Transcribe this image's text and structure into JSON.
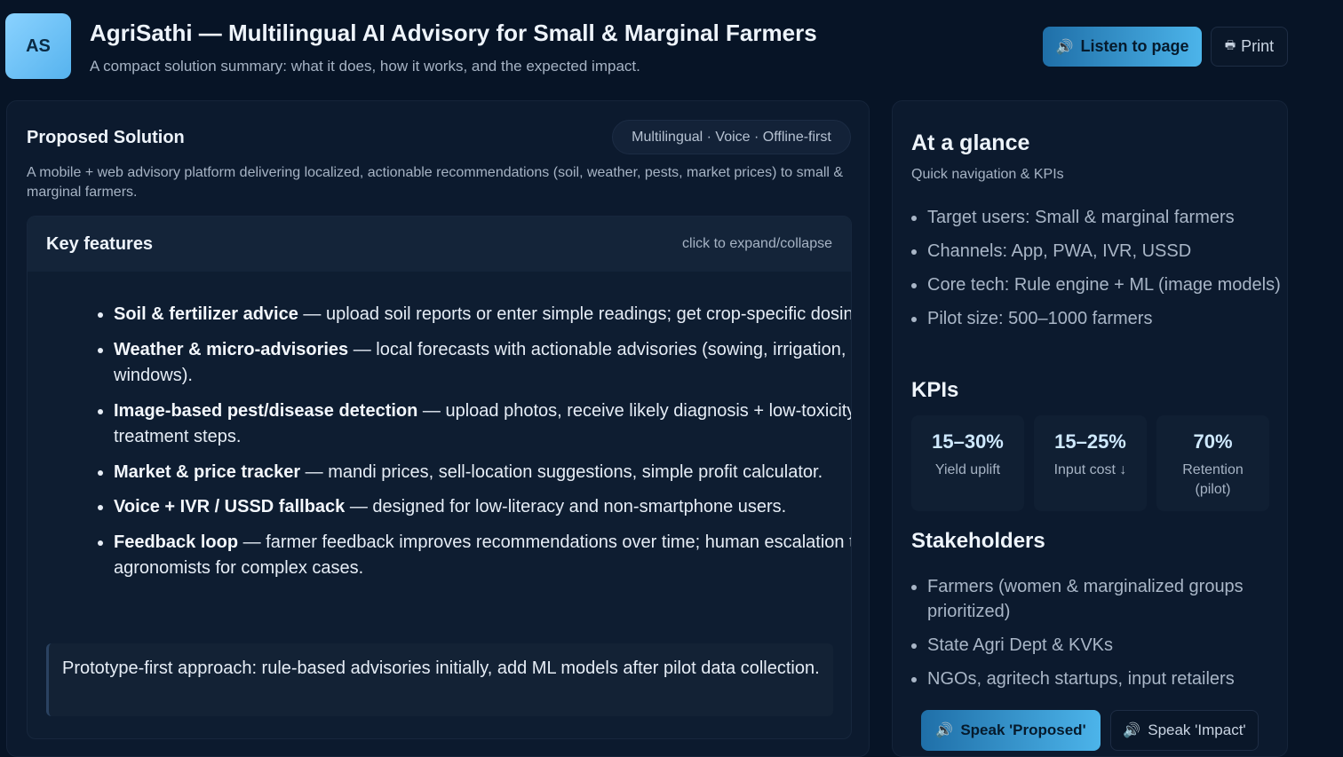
{
  "header": {
    "logo_text": "AS",
    "title": "AgriSathi — Multilingual AI Advisory for Small & Marginal Farmers",
    "subtitle": "A compact solution summary: what it does, how it works, and the expected impact.",
    "listen_label": "Listen to page",
    "listen_icon": "🔊",
    "print_label": "Print",
    "print_icon": "🖶"
  },
  "proposed": {
    "title": "Proposed Solution",
    "pill": "Multilingual · Voice · Offline-first",
    "description": "A mobile + web advisory platform delivering localized, actionable recommendations (soil, weather, pests, market prices) to small & marginal farmers.",
    "features_title": "Key features",
    "features_hint": "click to expand/collapse",
    "features": [
      {
        "name": "Soil & fertilizer advice",
        "text": " — upload soil reports or enter simple readings; get crop-specific dosing."
      },
      {
        "name": "Weather & micro-advisories",
        "text": " — local forecasts with actionable advisories (sowing, irrigation, spray windows)."
      },
      {
        "name": "Image-based pest/disease detection",
        "text": " — upload photos, receive likely diagnosis + low-toxicity treatment steps."
      },
      {
        "name": "Market & price tracker",
        "text": " — mandi prices, sell-location suggestions, simple profit calculator."
      },
      {
        "name": "Voice + IVR / USSD fallback",
        "text": " — designed for low-literacy and non-smartphone users."
      },
      {
        "name": "Feedback loop",
        "text": " — farmer feedback improves recommendations over time; human escalation to agronomists for complex cases."
      }
    ],
    "note": "Prototype-first approach: rule-based advisories initially, add ML models after pilot data collection."
  },
  "glance": {
    "title": "At a glance",
    "subtitle": "Quick navigation & KPIs",
    "items": [
      "Target users: Small & marginal farmers",
      "Channels: App, PWA, IVR, USSD",
      "Core tech: Rule engine + ML (image models)",
      "Pilot size: 500–1000 farmers"
    ],
    "kpi_title": "KPIs",
    "kpis": [
      {
        "value": "15–30%",
        "label": "Yield uplift"
      },
      {
        "value": "15–25%",
        "label": "Input cost ↓"
      },
      {
        "value": "70%",
        "label": "Retention (pilot)"
      }
    ],
    "stakeholders_title": "Stakeholders",
    "stakeholders": [
      "Farmers (women & marginalized groups prioritized)",
      "State Agri Dept & KVKs",
      "NGOs, agritech startups, input retailers"
    ],
    "speak_proposed": "Speak 'Proposed'",
    "speak_impact": "Speak 'Impact'",
    "speak_icon": "🔊"
  }
}
